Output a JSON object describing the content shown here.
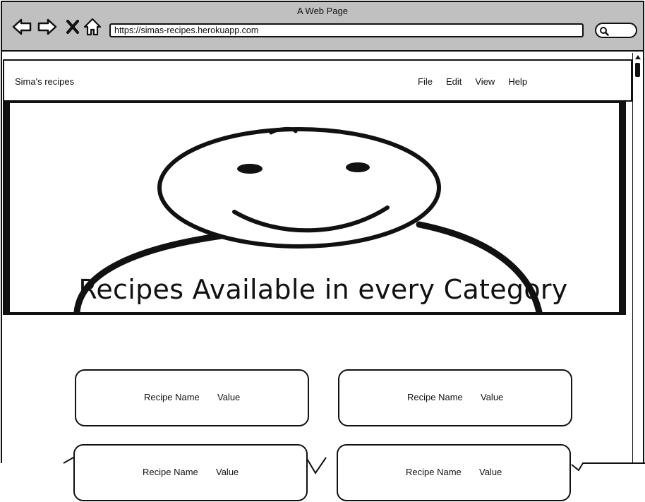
{
  "window": {
    "title": "A Web Page"
  },
  "address_bar": {
    "url": "https://simas-recipes.herokuapp.com"
  },
  "navbar": {
    "brand": "Sima's recipes",
    "menu": [
      {
        "label": "File"
      },
      {
        "label": "Edit"
      },
      {
        "label": "View"
      },
      {
        "label": "Help"
      }
    ]
  },
  "hero": {
    "icon": "smiley-person-icon"
  },
  "main": {
    "heading": "Recipes Available in every Category",
    "cards": [
      {
        "name": "Recipe Name",
        "value": "Value"
      },
      {
        "name": "Recipe Name",
        "value": "Value"
      },
      {
        "name": "Recipe Name",
        "value": "Value"
      },
      {
        "name": "Recipe Name",
        "value": "Value"
      }
    ]
  },
  "colors": {
    "chrome": "#c0c0c0",
    "ink": "#111111",
    "page": "#ffffff"
  }
}
